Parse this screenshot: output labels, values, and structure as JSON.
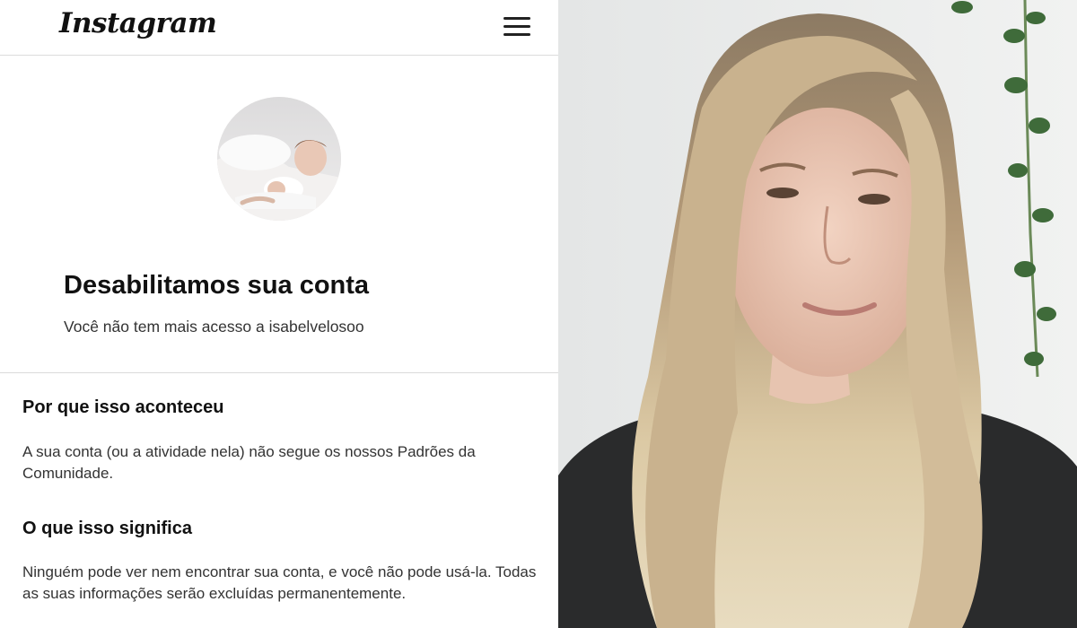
{
  "header": {
    "logo_text": "Instagram",
    "menu_icon": "hamburger-menu-icon"
  },
  "profile": {
    "avatar_description_icon": "profile-photo-avatar"
  },
  "notice": {
    "title": "Desabilitamos sua conta",
    "subtitle": "Você não tem mais acesso a isabelvelosoo"
  },
  "sections": [
    {
      "heading": "Por que isso aconteceu",
      "body": "A sua conta (ou a atividade nela) não segue os nossos Padrões da Comunidade."
    },
    {
      "heading": "O que isso significa",
      "body": "Ninguém pode ver nem encontrar sua conta, e você não pode usá-la. Todas as suas informações serão excluídas permanentemente."
    }
  ],
  "colors": {
    "text_dark": "#111111",
    "text_body": "#333333",
    "divider": "#dbdbdb",
    "background": "#ffffff"
  }
}
